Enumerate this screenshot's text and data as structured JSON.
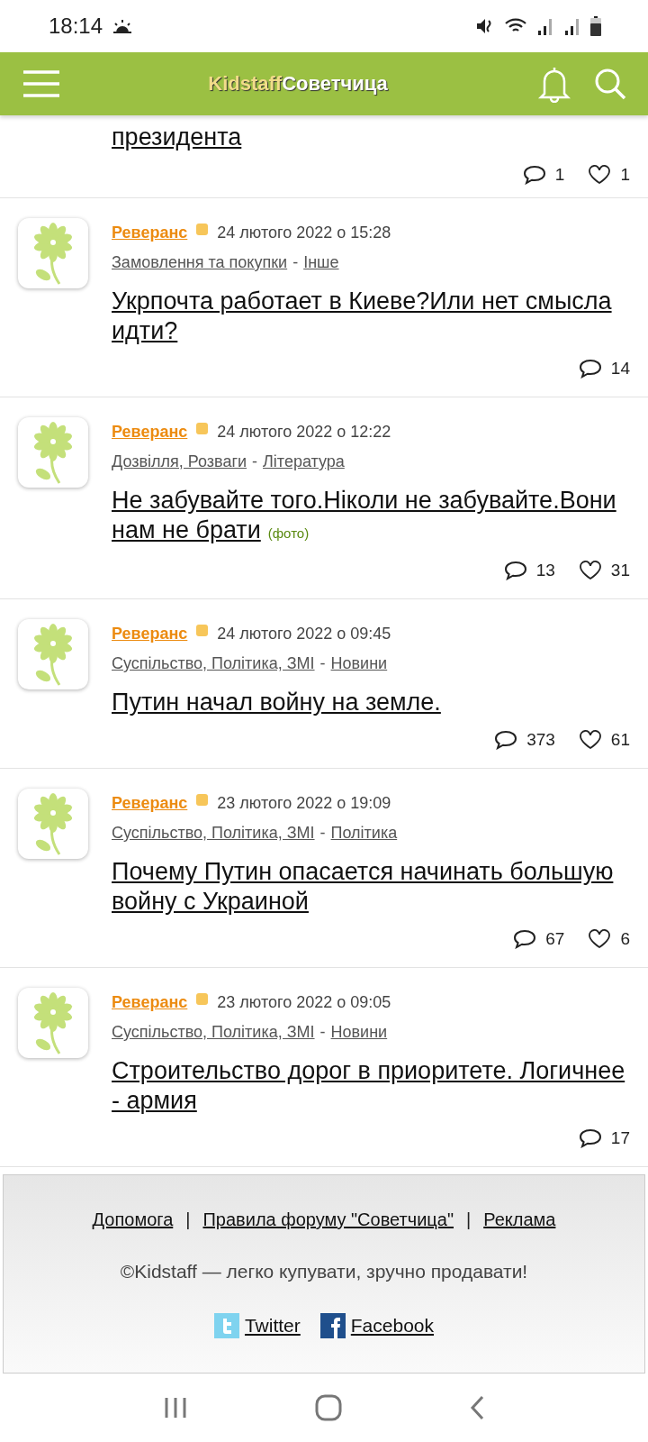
{
  "status_bar": {
    "time": "18:14"
  },
  "header": {
    "logo_left": "Kidstaff",
    "logo_right": "Советчица"
  },
  "top_fragment": {
    "title": "президента",
    "comments": "1",
    "likes": "1"
  },
  "posts": [
    {
      "author": "Реверанс",
      "date": "24 лютого 2022 о 15:28",
      "category": "Замовлення та покупки",
      "subcategory": "Інше",
      "title": "Укрпочта работает в Киеве?Или нет смысла идти?",
      "comments": "14"
    },
    {
      "author": "Реверанс",
      "date": "24 лютого 2022 о 12:22",
      "category": "Дозвілля, Розваги",
      "subcategory": "Література",
      "title": "Не забувайте того.Ніколи не забувайте.Вони нам не брати",
      "tag": "(фото)",
      "comments": "13",
      "likes": "31"
    },
    {
      "author": "Реверанс",
      "date": "24 лютого 2022 о 09:45",
      "category": "Суспільство, Політика, ЗМІ",
      "subcategory": "Новини",
      "title": "Путин начал войну на земле.",
      "comments": "373",
      "likes": "61"
    },
    {
      "author": "Реверанс",
      "date": "23 лютого 2022 о 19:09",
      "category": "Суспільство, Політика, ЗМІ",
      "subcategory": "Політика",
      "title": "Почему Путин опасается начинать большую войну с Украиной",
      "comments": "67",
      "likes": "6"
    },
    {
      "author": "Реверанс",
      "date": "23 лютого 2022 о 09:05",
      "category": "Суспільство, Політика, ЗМІ",
      "subcategory": "Новини",
      "title": "Строительство дорог в приоритете. Логичнее - армия",
      "comments": "17"
    }
  ],
  "category_separator": "-",
  "footer": {
    "links": [
      "Допомога",
      "Правила форуму \"Советчица\"",
      "Реклама"
    ],
    "separator": "|",
    "tagline": "©Kidstaff — легко купувати, зручно продавати!",
    "social": [
      {
        "kind": "twitter",
        "label": "Twitter"
      },
      {
        "kind": "facebook",
        "label": "Facebook"
      }
    ]
  }
}
